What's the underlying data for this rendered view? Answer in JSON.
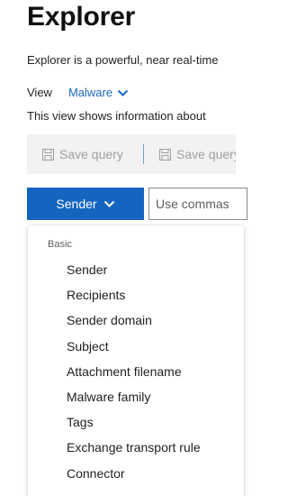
{
  "header": {
    "title": "Explorer",
    "description": "Explorer is a powerful, near real-time"
  },
  "view": {
    "label": "View",
    "selected": "Malware",
    "info": "This view shows information about"
  },
  "toolbar": {
    "save_query_label": "Save query",
    "save_query_as_label": "Save query"
  },
  "filter": {
    "field_label": "Sender",
    "input_placeholder": "Use commas"
  },
  "dropdown": {
    "group_label": "Basic",
    "items": [
      "Sender",
      "Recipients",
      "Sender domain",
      "Subject",
      "Attachment filename",
      "Malware family",
      "Tags",
      "Exchange transport rule",
      "Connector"
    ]
  },
  "colors": {
    "accent": "#1565c0",
    "link": "#1a67c4",
    "toolbar_bg": "#f3f2f1",
    "disabled_text": "#a19f9d"
  },
  "icons": {
    "view_chevron": "chevron-down-icon",
    "save": "save-icon",
    "sender_chevron": "chevron-down-icon"
  }
}
